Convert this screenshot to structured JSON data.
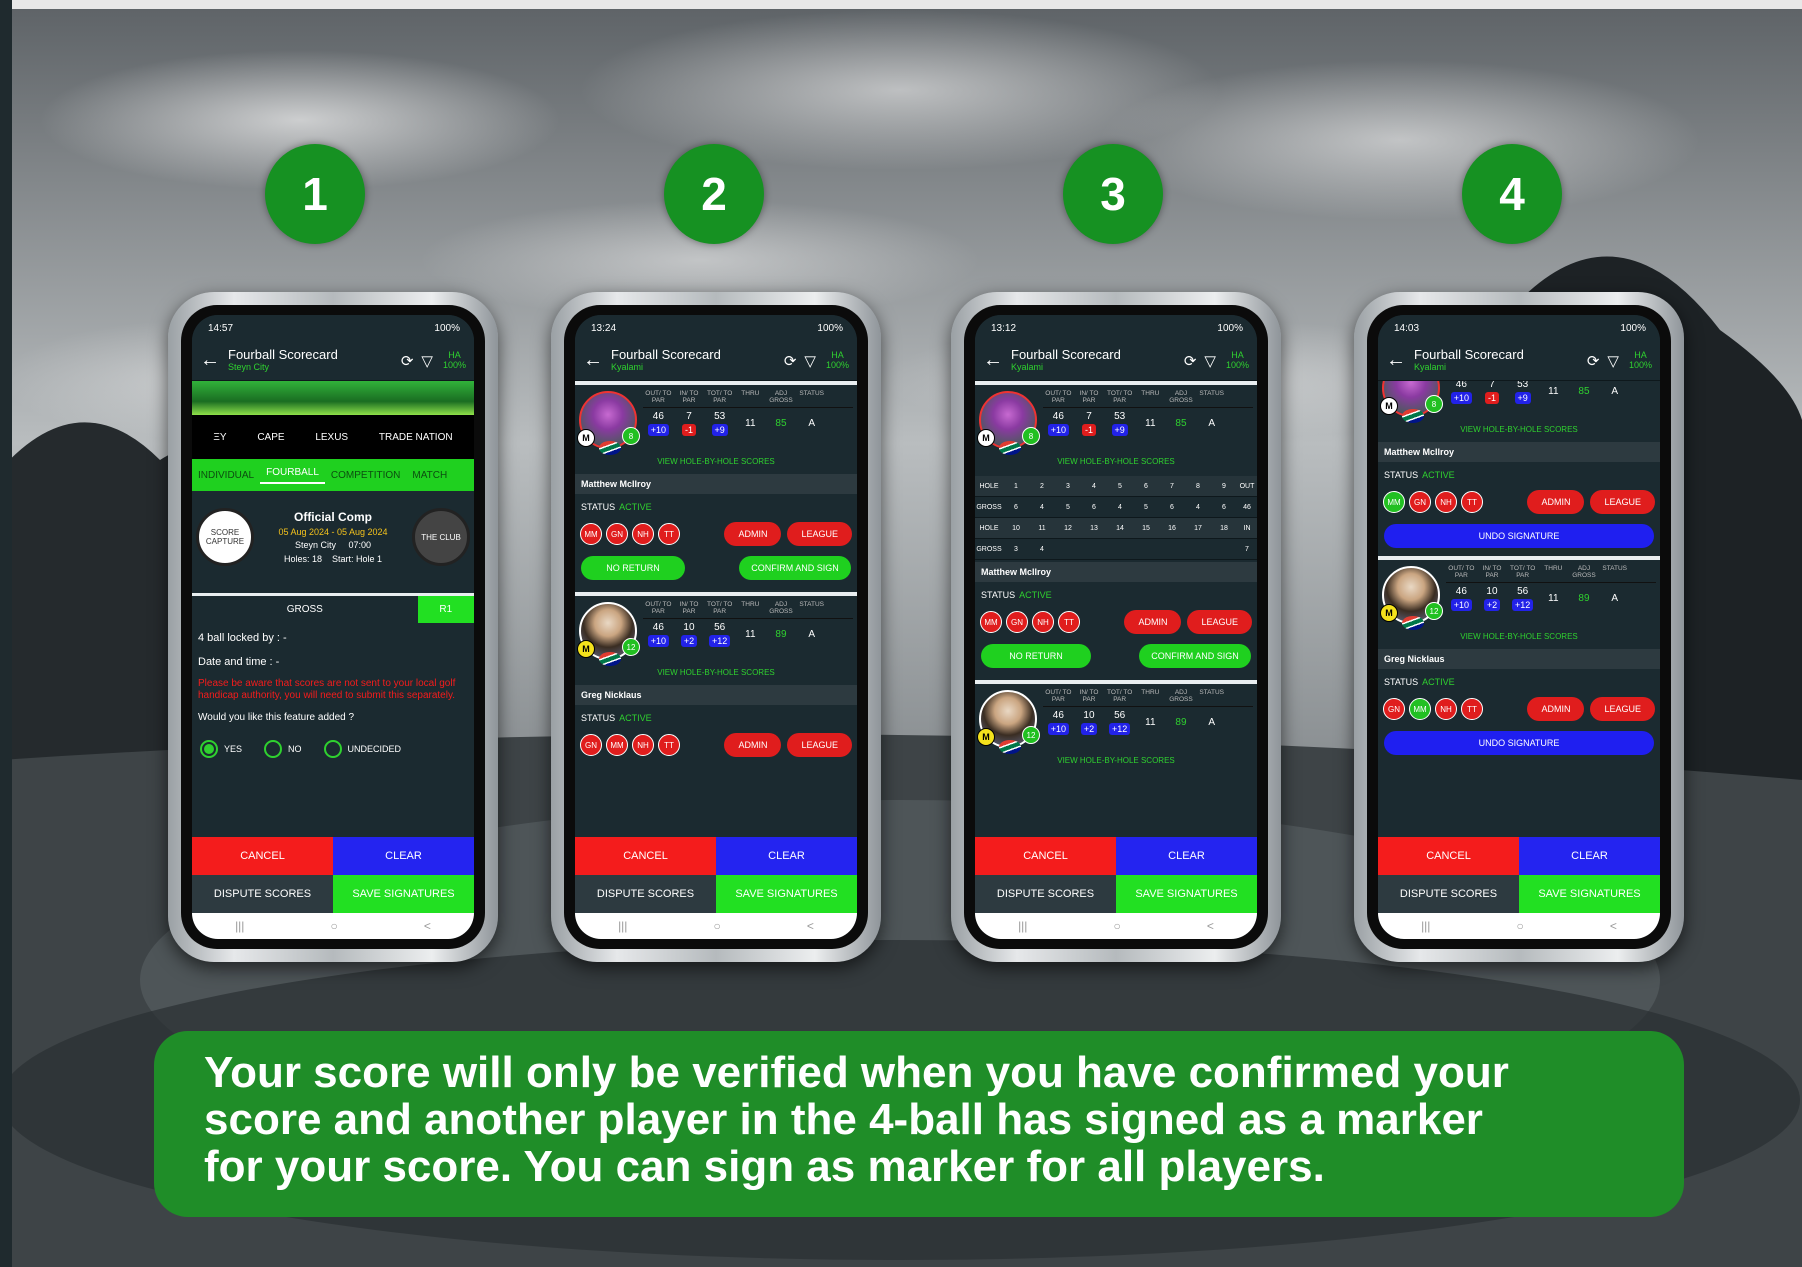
{
  "steps": [
    "1",
    "2",
    "3",
    "4"
  ],
  "caption": {
    "line1": "Your score will only be verified when you have confirmed your",
    "line2": "score and another player in the 4-ball has signed as a marker",
    "line3": "for your score.  You can sign as marker for all players."
  },
  "phones": [
    {
      "time": "14:57",
      "battery": "100%",
      "title": "Fourball Scorecard",
      "subtitle": "Steyn City",
      "ha": "HA",
      "ha_pct": "100%"
    },
    {
      "time": "13:24",
      "battery": "100%",
      "title": "Fourball Scorecard",
      "subtitle": "Kyalami",
      "ha": "HA",
      "ha_pct": "100%"
    },
    {
      "time": "13:12",
      "battery": "100%",
      "title": "Fourball Scorecard",
      "subtitle": "Kyalami",
      "ha": "HA",
      "ha_pct": "100%"
    },
    {
      "time": "14:03",
      "battery": "100%",
      "title": "Fourball Scorecard",
      "subtitle": "Kyalami",
      "ha": "HA",
      "ha_pct": "100%"
    }
  ],
  "s1": {
    "sponsors": [
      "ΞY",
      "CAPE",
      "LEXUS",
      "TRADE NATION"
    ],
    "tabs": [
      "INDIVIDUAL",
      "FOURBALL",
      "COMPETITION",
      "MATCH"
    ],
    "comp_title": "Official Comp",
    "comp_dates": "05 Aug 2024 - 05 Aug 2024",
    "comp_venue": "Steyn City",
    "comp_time": "07:00",
    "comp_holes": "Holes: 18",
    "comp_start": "Start: Hole 1",
    "logo_left": "SCORE CAPTURE",
    "logo_right": "THE CLUB",
    "gross": "GROSS",
    "r1": "R1",
    "locked": "4 ball locked by : -",
    "datetime": "Date and time : -",
    "warning": "Please be aware that scores are not sent to your local golf handicap authority, you will need to submit this separately.",
    "question": "Would you like this feature added ?",
    "opts": [
      "YES",
      "NO",
      "UNDECIDED"
    ]
  },
  "labels": {
    "cancel": "CANCEL",
    "clear": "CLEAR",
    "dispute": "DISPUTE SCORES",
    "save": "SAVE SIGNATURES",
    "view": "VIEW HOLE-BY-HOLE SCORES",
    "status": "STATUS",
    "active": "ACTIVE",
    "no_return": "NO RETURN",
    "confirm": "CONFIRM AND SIGN",
    "admin": "ADMIN",
    "league": "LEAGUE",
    "undo": "UNDO SIGNATURE"
  },
  "stat_headers": [
    "OUT/ TO PAR",
    "IN/ TO PAR",
    "TOT/ TO PAR",
    "THRU",
    "ADJ GROSS",
    "STATUS"
  ],
  "players": {
    "mm": {
      "name": "Matthew McIlroy",
      "init": "M",
      "num": "8",
      "out": "46",
      "out_par": "+10",
      "in": "7",
      "in_par": "-1",
      "tot": "53",
      "tot_par": "+9",
      "thru": "11",
      "adj": "85",
      "st": "A"
    },
    "gn": {
      "name": "Greg Nicklaus",
      "init": "M",
      "num": "12",
      "out": "46",
      "out_par": "+10",
      "in": "10",
      "in_par": "+2",
      "tot": "56",
      "tot_par": "+12",
      "thru": "11",
      "adj": "89",
      "st": "A"
    }
  },
  "chips_mm": [
    "MM",
    "GN",
    "NH",
    "TT"
  ],
  "chips_gn": [
    "GN",
    "MM",
    "NH",
    "TT"
  ],
  "holes": {
    "front": [
      "HOLE",
      "1",
      "2",
      "3",
      "4",
      "5",
      "6",
      "7",
      "8",
      "9",
      "OUT"
    ],
    "front_gross": [
      "GROSS",
      "6",
      "4",
      "5",
      "6",
      "4",
      "5",
      "6",
      "4",
      "6",
      "46"
    ],
    "back": [
      "HOLE",
      "10",
      "11",
      "12",
      "13",
      "14",
      "15",
      "16",
      "17",
      "18",
      "IN"
    ],
    "back_gross": [
      "GROSS",
      "3",
      "4",
      "",
      "",
      "",
      "",
      "",
      "",
      "",
      "7"
    ]
  },
  "nav": [
    "|||",
    "○",
    "<"
  ]
}
